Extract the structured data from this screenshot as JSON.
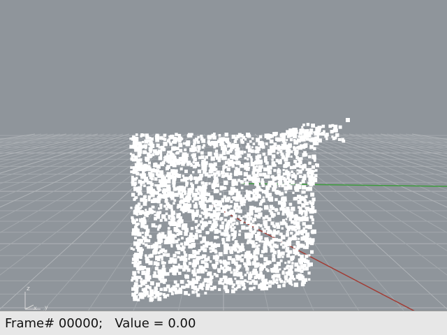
{
  "status": {
    "text": "Frame# 00000;   Value = 0.00"
  },
  "viewport": {
    "background_color": "#8f959b",
    "grid_color": "#a3a8ad",
    "grid_major_color": "#b0b4b8",
    "x_axis_color": "#a23b33",
    "y_axis_color": "#3d9a3d",
    "particle_color": "#ffffff",
    "axis_gizmo_labels": {
      "z": "z",
      "x": "x",
      "y": "y"
    }
  }
}
